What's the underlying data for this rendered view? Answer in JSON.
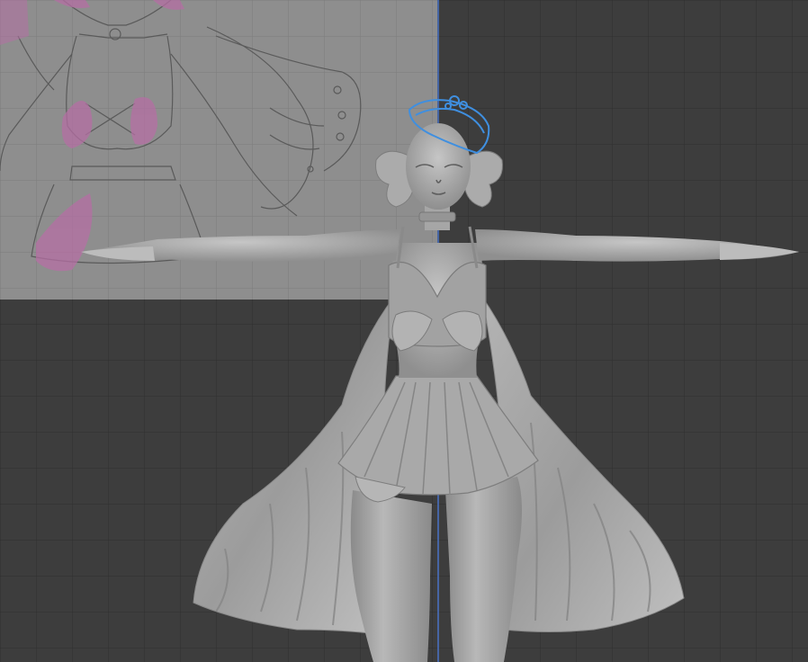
{
  "viewport": {
    "background": "#3d3d3d",
    "grid_color": "#2f2f2f",
    "reference_panel_color": "#8e8e8e",
    "reference_grid_color": "#7c7c7c",
    "sketch_color": "#5a5a5a",
    "sketch_fill_color": "#b56fa4",
    "axis_color": "#4a73c6",
    "model_color": "#a8a8a8",
    "model_highlight": "#c8c8c8",
    "model_shadow": "#7a7a7a",
    "selection_color": "#3f8fe0"
  }
}
